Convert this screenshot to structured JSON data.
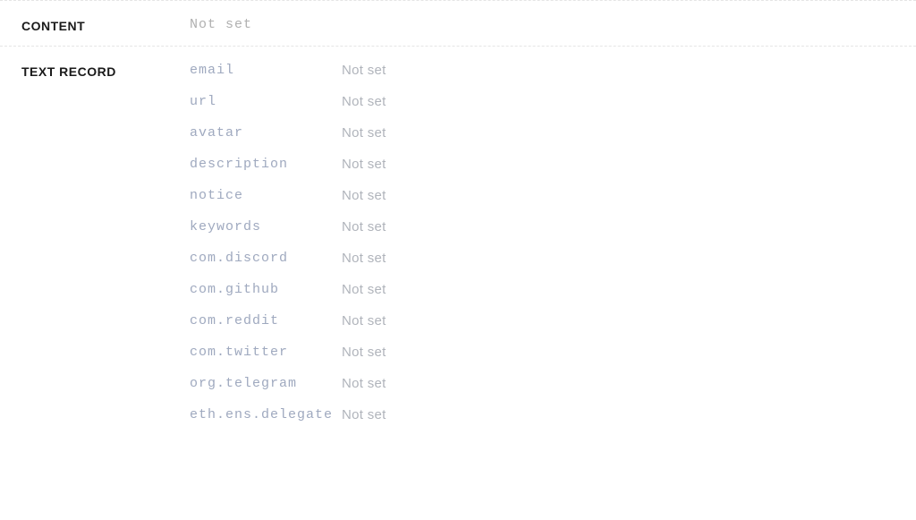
{
  "content": {
    "label": "CONTENT",
    "value": "Not set"
  },
  "text_record": {
    "label": "TEXT RECORD",
    "records": [
      {
        "key": "email",
        "value": "Not set"
      },
      {
        "key": "url",
        "value": "Not set"
      },
      {
        "key": "avatar",
        "value": "Not set"
      },
      {
        "key": "description",
        "value": "Not set"
      },
      {
        "key": "notice",
        "value": "Not set"
      },
      {
        "key": "keywords",
        "value": "Not set"
      },
      {
        "key": "com.discord",
        "value": "Not set"
      },
      {
        "key": "com.github",
        "value": "Not set"
      },
      {
        "key": "com.reddit",
        "value": "Not set"
      },
      {
        "key": "com.twitter",
        "value": "Not set"
      },
      {
        "key": "org.telegram",
        "value": "Not set"
      },
      {
        "key": "eth.ens.delegate",
        "value": "Not set"
      }
    ]
  }
}
